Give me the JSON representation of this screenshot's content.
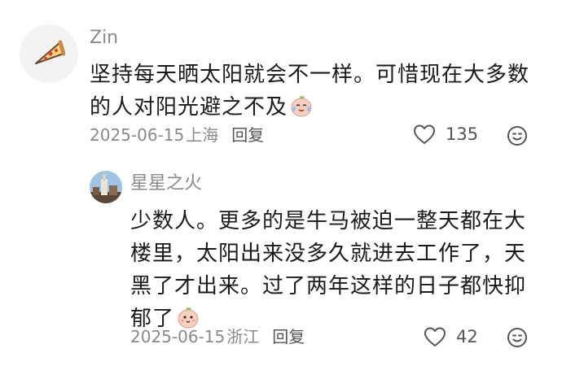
{
  "comments": [
    {
      "username": "Zin",
      "avatar_icon": "pizza-slice-icon",
      "text": "坚持每天晒太阳就会不一样。可惜现在大多数的人对阳光避之不及",
      "emoji": "crying-laughing-peach-emoji",
      "date": "2025-06-15",
      "location": "上海",
      "reply_label": "回复",
      "likes": "135"
    },
    {
      "username": "星星之火",
      "avatar_icon": "building-photo-avatar",
      "text": "少数人。更多的是牛马被迫一整天都在大楼里，太阳出来没多久就进去工作了，天黑了才出来。过了两年这样的日子都快抑郁了",
      "emoji": "peach-face-emoji",
      "date": "2025-06-15",
      "location": "浙江",
      "reply_label": "回复",
      "likes": "42"
    }
  ],
  "icons": {
    "like": "heart-outline-icon",
    "more": "comment-smile-icon"
  }
}
